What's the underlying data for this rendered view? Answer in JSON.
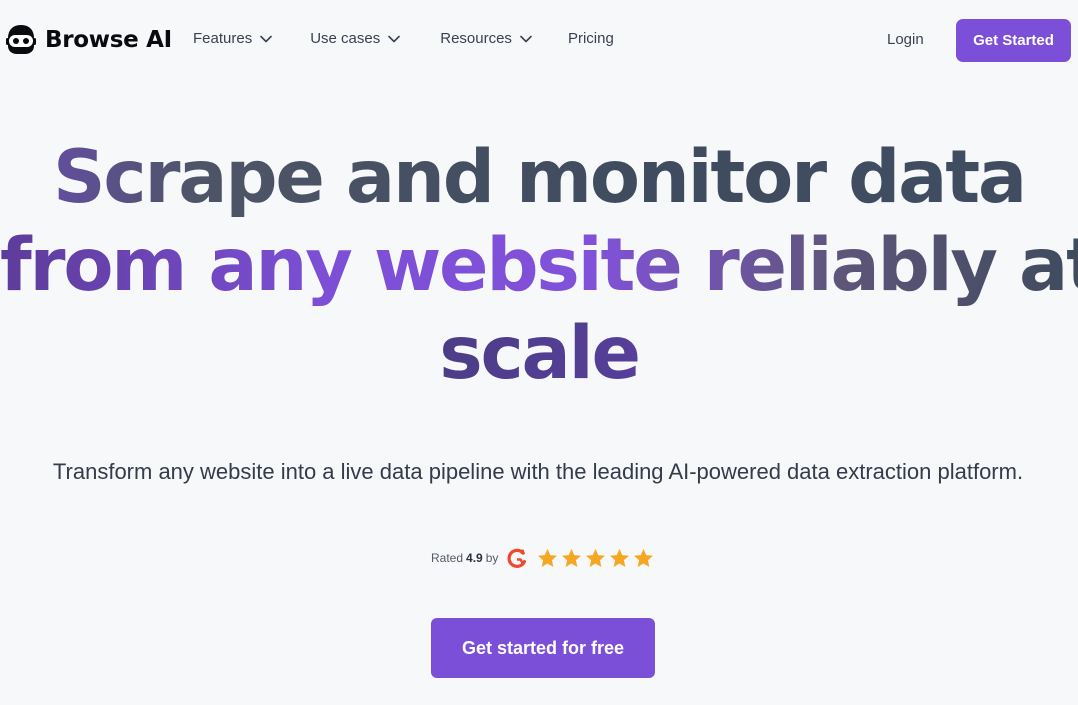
{
  "brand": {
    "name": "Browse AI",
    "logo_icon": "robot-face-icon"
  },
  "nav": {
    "items": [
      {
        "label": "Features",
        "has_dropdown": true
      },
      {
        "label": "Use cases",
        "has_dropdown": true
      },
      {
        "label": "Resources",
        "has_dropdown": true
      },
      {
        "label": "Pricing",
        "has_dropdown": false
      }
    ],
    "login_label": "Login",
    "get_started_label": "Get Started"
  },
  "hero": {
    "title_lines": [
      "Scrape and monitor data",
      "from any website reliably at",
      "scale"
    ],
    "subtitle": "Transform any website into a live data pipeline with the leading AI-powered data extraction platform.",
    "rating": {
      "prefix": "Rated",
      "score": "4.9",
      "suffix": "by",
      "source_icon": "g2-logo-icon",
      "stars": 5
    },
    "cta_label": "Get started for free"
  },
  "colors": {
    "accent": "#7b4fd8",
    "background": "#f7f8fa",
    "text": "#3f4657",
    "star": "#f5a623",
    "g2": "#ef492d"
  }
}
